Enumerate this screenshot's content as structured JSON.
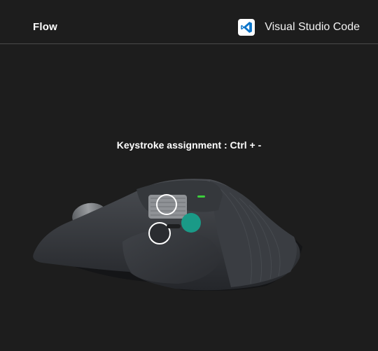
{
  "header": {
    "tab_label": "Flow",
    "app_name": "Visual Studio Code",
    "app_icon": "vscode-icon"
  },
  "main": {
    "assignment_text": "Keystroke assignment : Ctrl + -"
  },
  "colors": {
    "background": "#1d1d1d",
    "accent_teal": "#1a9a87",
    "indicator_green": "#3ccf3c",
    "divider": "#4a4a4a"
  }
}
